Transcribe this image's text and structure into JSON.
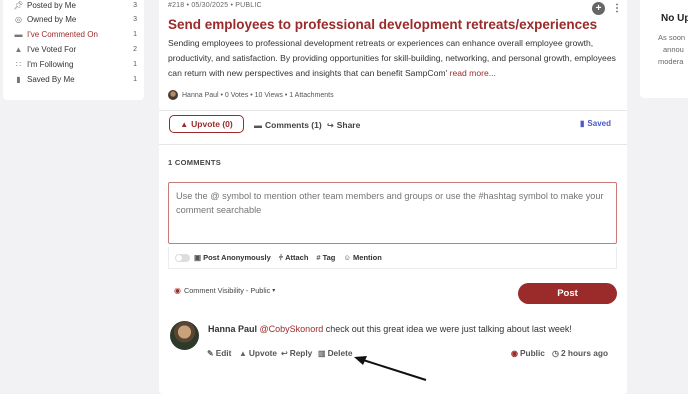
{
  "sidebar": {
    "items": [
      {
        "label": "Posted by Me",
        "count": "3",
        "icon": "pin-icon"
      },
      {
        "label": "Owned by Me",
        "count": "3",
        "icon": "owner-icon"
      },
      {
        "label": "I've Commented On",
        "count": "1",
        "icon": "comment-icon",
        "active": true
      },
      {
        "label": "I've Voted For",
        "count": "2",
        "icon": "thumbs-up-icon"
      },
      {
        "label": "I'm Following",
        "count": "1",
        "icon": "rss-icon"
      },
      {
        "label": "Saved By Me",
        "count": "1",
        "icon": "bookmark-icon"
      }
    ]
  },
  "right_panel": {
    "title": "No Up",
    "lines": [
      "As soon",
      "annou",
      "modera"
    ]
  },
  "post": {
    "meta": "#218 • 05/30/2025 • PUBLIC",
    "title": "Send employees to professional development retreats/experiences",
    "description": "Sending employees to professional development retreats or experiences can enhance overall employee growth, productivity, and satisfaction. By providing opportunities for skill-building, networking, and personal growth, employees can return with new perspectives and insights that can benefit SampCom'",
    "read_more": "read more...",
    "author_line": "Hanna Paul • 0 Votes • 10 Views • 1 Attachments",
    "upvote_label": "Upvote (0)",
    "comments_label": "Comments (1)",
    "share_label": "Share",
    "saved_label": "Saved"
  },
  "comments": {
    "header": "1 COMMENTS",
    "placeholder": "Use the @ symbol to mention other team members and groups or use the #hashtag symbol to make your comment searchable",
    "tools": {
      "anonymous": "Post Anonymously",
      "attach": "Attach",
      "tag": "Tag",
      "mention": "Mention"
    },
    "visibility": "Comment Visibility - Public",
    "post_button": "Post",
    "items": [
      {
        "author": "Hanna Paul",
        "mention": "@CobySkonord",
        "text": " check out this great idea we were just talking about last week!",
        "actions": {
          "edit": "Edit",
          "upvote": "Upvote",
          "reply": "Reply",
          "delete": "Delete"
        },
        "visibility": "Public",
        "time": "2 hours ago"
      }
    ]
  },
  "colors": {
    "accent": "#9b2a2a",
    "saved": "#4a58c9",
    "background": "#f2f2f4"
  }
}
